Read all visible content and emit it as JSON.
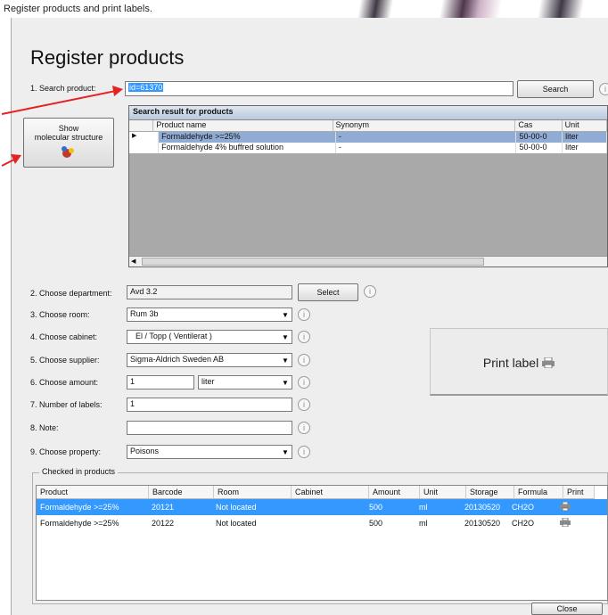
{
  "window": {
    "title": "Register products and print labels."
  },
  "header": {
    "title": "Register products"
  },
  "search": {
    "label": "1. Search product:",
    "value": "id=61370",
    "button": "Search"
  },
  "molecule_button": {
    "line1": "Show",
    "line2": "molecular structure"
  },
  "results": {
    "heading": "Search result for products",
    "columns": [
      "Product name",
      "Synonym",
      "Cas",
      "Unit"
    ],
    "rows": [
      {
        "name": "Formaldehyde >=25%",
        "synonym": "-",
        "cas": "50-00-0",
        "unit": "liter",
        "selected": true
      },
      {
        "name": "Formaldehyde 4% buffred solution",
        "synonym": "-",
        "cas": "50-00-0",
        "unit": "liter",
        "selected": false
      }
    ]
  },
  "form": {
    "department": {
      "label": "2. Choose department:",
      "value": "Avd 3.2",
      "button": "Select"
    },
    "room": {
      "label": "3. Choose room:",
      "value": "Rum 3b"
    },
    "cabinet": {
      "label": "4. Choose cabinet:",
      "value": "El / Topp ( Ventilerat )"
    },
    "supplier": {
      "label": "5. Choose supplier:",
      "value": "Sigma-Aldrich Sweden AB"
    },
    "amount": {
      "label": "6. Choose amount:",
      "value": "1",
      "unit": "liter"
    },
    "labels": {
      "label": "7. Number of labels:",
      "value": "1"
    },
    "note": {
      "label": "8. Note:",
      "value": ""
    },
    "property": {
      "label": "9. Choose property:",
      "value": "Poisons"
    }
  },
  "print_label": {
    "label": "Print label"
  },
  "checked": {
    "legend": "Checked in products",
    "columns": [
      "Product",
      "Barcode",
      "Room",
      "Cabinet",
      "Amount",
      "Unit",
      "Storage",
      "Formula",
      "Print"
    ],
    "rows": [
      {
        "product": "Formaldehyde >=25%",
        "barcode": "20121",
        "room": "Not located",
        "cabinet": "",
        "amount": "500",
        "unit": "ml",
        "storage": "20130520",
        "formula": "CH2O",
        "selected": true
      },
      {
        "product": "Formaldehyde >=25%",
        "barcode": "20122",
        "room": "Not located",
        "cabinet": "",
        "amount": "500",
        "unit": "ml",
        "storage": "20130520",
        "formula": "CH2O",
        "selected": false
      }
    ]
  },
  "footer": {
    "close": "Close"
  },
  "colors": {
    "selection": "#3399ff",
    "result_selection": "#90acd4",
    "arrow": "#e52222"
  },
  "icons": [
    "molecule-icon",
    "info-icon",
    "printer-icon",
    "chevron-down-icon"
  ]
}
